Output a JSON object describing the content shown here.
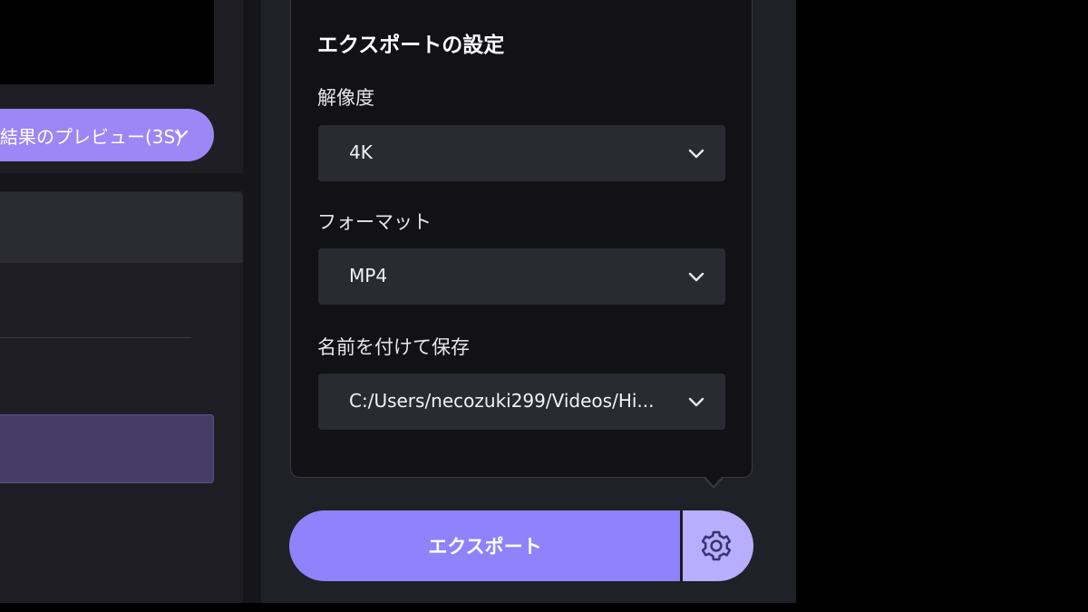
{
  "left": {
    "preview_button_label": "結果のプレビュー(3S)"
  },
  "export_settings": {
    "title": "エクスポートの設定",
    "resolution": {
      "label": "解像度",
      "value": "4K"
    },
    "format": {
      "label": "フォーマット",
      "value": "MP4"
    },
    "save_as": {
      "label": "名前を付けて保存",
      "value": "C:/Users/necozuki299/Videos/Hi..."
    }
  },
  "footer": {
    "export_label": "エクスポート"
  },
  "icons": {
    "dropdown": "chevron-down-icon",
    "settings": "gear-icon"
  },
  "colors": {
    "accent": "#8f82fb",
    "accent_light": "#b9adff",
    "panel_bg": "#111116",
    "select_bg": "#2a2a33"
  }
}
